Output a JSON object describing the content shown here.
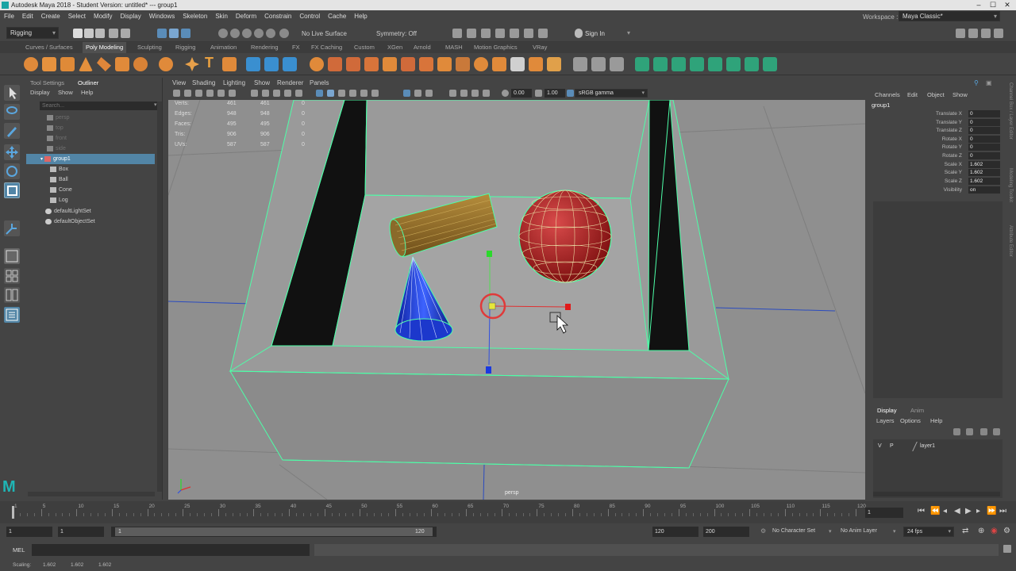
{
  "window": {
    "title": "Autodesk Maya 2018 - Student Version: untitled*   ---   group1"
  },
  "menu": [
    "File",
    "Edit",
    "Create",
    "Select",
    "Modify",
    "Display",
    "Windows",
    "Skeleton",
    "Skin",
    "Deform",
    "Constrain",
    "Control",
    "Cache",
    "Help"
  ],
  "workspace": {
    "label": "Workspace :",
    "value": "Maya Classic*"
  },
  "statusline": {
    "menuset": "Rigging",
    "live_surface": "No Live Surface",
    "symmetry": "Symmetry: Off",
    "sign_in": "Sign In"
  },
  "shelf_tabs": [
    "Curves / Surfaces",
    "Poly Modeling",
    "Sculpting",
    "Rigging",
    "Animation",
    "Rendering",
    "FX",
    "FX Caching",
    "Custom",
    "XGen",
    "Arnold",
    "MASH",
    "Motion Graphics",
    "VRay"
  ],
  "outliner": {
    "tabs": [
      "Tool Settings",
      "Outliner"
    ],
    "menus": [
      "Display",
      "Show",
      "Help"
    ],
    "search_placeholder": "Search...",
    "items": [
      {
        "label": "persp",
        "dim": true
      },
      {
        "label": "top",
        "dim": true
      },
      {
        "label": "front",
        "dim": true
      },
      {
        "label": "side",
        "dim": true
      },
      {
        "label": "group1",
        "selected": true
      },
      {
        "label": "Box"
      },
      {
        "label": "Ball"
      },
      {
        "label": "Cone"
      },
      {
        "label": "Log"
      },
      {
        "label": "defaultLightSet"
      },
      {
        "label": "defaultObjectSet"
      }
    ]
  },
  "viewport": {
    "menus": [
      "View",
      "Shading",
      "Lighting",
      "Show",
      "Renderer",
      "Panels"
    ],
    "exposure": "0.00",
    "gamma": "1.00",
    "color_space": "sRGB gamma",
    "camera_label": "persp",
    "hud": [
      {
        "label": "Verts:",
        "a": "461",
        "b": "461",
        "c": "0"
      },
      {
        "label": "Edges:",
        "a": "948",
        "b": "948",
        "c": "0"
      },
      {
        "label": "Faces:",
        "a": "495",
        "b": "495",
        "c": "0"
      },
      {
        "label": "Tris:",
        "a": "906",
        "b": "906",
        "c": "0"
      },
      {
        "label": "UVs:",
        "a": "587",
        "b": "587",
        "c": "0"
      }
    ]
  },
  "channel_box": {
    "menus": [
      "Channels",
      "Edit",
      "Object",
      "Show"
    ],
    "object": "group1",
    "attrs": [
      {
        "name": "Translate X",
        "value": "0"
      },
      {
        "name": "Translate Y",
        "value": "0"
      },
      {
        "name": "Translate Z",
        "value": "0"
      },
      {
        "name": "Rotate X",
        "value": "0"
      },
      {
        "name": "Rotate Y",
        "value": "0"
      },
      {
        "name": "Rotate Z",
        "value": "0"
      },
      {
        "name": "Scale X",
        "value": "1.602"
      },
      {
        "name": "Scale Y",
        "value": "1.602"
      },
      {
        "name": "Scale Z",
        "value": "1.602"
      },
      {
        "name": "Visibility",
        "value": "on"
      }
    ],
    "side_tabs": [
      "Channel Box / Layer Editor",
      "Modeling Toolkit",
      "Attribute Editor"
    ]
  },
  "layer_editor": {
    "tabs": [
      "Display",
      "Anim"
    ],
    "menus": [
      "Layers",
      "Options",
      "Help"
    ],
    "layer": {
      "v": "V",
      "p": "P",
      "name": "layer1"
    }
  },
  "timeline": {
    "ticks": [
      "1",
      "5",
      "10",
      "15",
      "20",
      "25",
      "30",
      "35",
      "40",
      "45",
      "50",
      "55",
      "60",
      "65",
      "70",
      "75",
      "80",
      "85",
      "90",
      "95",
      "100",
      "105",
      "110",
      "115",
      "120"
    ],
    "current_frame": "1"
  },
  "range": {
    "start": "1",
    "playback_start": "1",
    "slider_start": "1",
    "slider_end": "120",
    "playback_end": "120",
    "end": "200",
    "character_set": "No Character Set",
    "anim_layer": "No Anim Layer",
    "fps": "24 fps"
  },
  "command": {
    "lang": "MEL"
  },
  "help": {
    "label": "Scaling:",
    "values": [
      "1.602",
      "1.602",
      "1.602"
    ]
  }
}
